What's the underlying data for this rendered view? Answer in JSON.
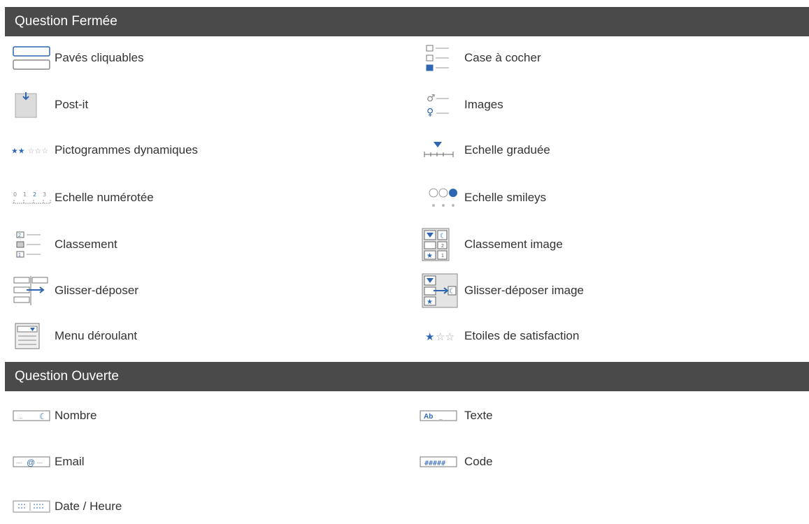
{
  "sections": {
    "closed": {
      "title": "Question Fermée",
      "left": [
        {
          "label": "Pavés cliquables",
          "icon": "clickable-tiles-icon"
        },
        {
          "label": "Post-it",
          "icon": "post-it-icon"
        },
        {
          "label": "Pictogrammes dynamiques",
          "icon": "dynamic-pictograms-icon"
        },
        {
          "label": "Echelle numérotée",
          "icon": "numbered-scale-icon"
        },
        {
          "label": "Classement",
          "icon": "ranking-icon"
        },
        {
          "label": "Glisser-déposer",
          "icon": "drag-drop-icon"
        },
        {
          "label": "Menu déroulant",
          "icon": "dropdown-menu-icon"
        }
      ],
      "right": [
        {
          "label": "Case à cocher",
          "icon": "checkbox-icon"
        },
        {
          "label": "Images",
          "icon": "images-icon"
        },
        {
          "label": "Echelle graduée",
          "icon": "graduated-scale-icon"
        },
        {
          "label": "Echelle smileys",
          "icon": "smiley-scale-icon"
        },
        {
          "label": "Classement image",
          "icon": "image-ranking-icon"
        },
        {
          "label": "Glisser-déposer image",
          "icon": "image-drag-drop-icon"
        },
        {
          "label": "Etoiles de satisfaction",
          "icon": "satisfaction-stars-icon"
        }
      ]
    },
    "open": {
      "title": "Question Ouverte",
      "left": [
        {
          "label": "Nombre",
          "icon": "number-field-icon"
        },
        {
          "label": "Email",
          "icon": "email-field-icon"
        },
        {
          "label": "Date / Heure",
          "icon": "date-time-icon"
        }
      ],
      "right": [
        {
          "label": "Texte",
          "icon": "text-field-icon"
        },
        {
          "label": "Code",
          "icon": "code-field-icon"
        }
      ]
    }
  },
  "colors": {
    "header_bg": "#4a4a4a",
    "header_text": "#ffffff",
    "icon_blue": "#2f66b3",
    "icon_gray": "#9a9a9a"
  }
}
